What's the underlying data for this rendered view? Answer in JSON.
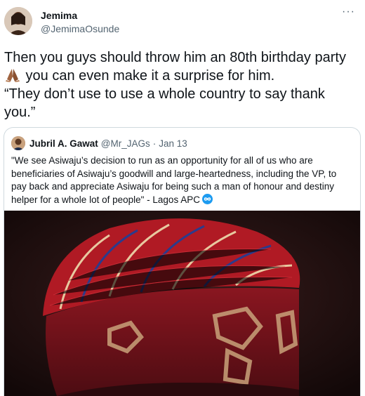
{
  "author": {
    "name": "Jemima",
    "handle": "@JemimaOsunde"
  },
  "more_label": "···",
  "tweet": {
    "line1_a": "Then you guys should throw him an 80th birthday party",
    "line2_b": " you can even make it a surprise for him.",
    "line3": "“They don’t use to use a whole country to say thank you.”",
    "emoji_icon": "folded-hands-icon"
  },
  "quote": {
    "name": "Jubril A. Gawat",
    "handle": "@Mr_JAGs",
    "separator": "·",
    "date": "Jan 13",
    "text": "\"We see Asiwaju’s decision to run as an opportunity for all of us who are beneficiaries of Asiwaju’s goodwill and large-heartedness, including the VP, to pay back and appreciate Asiwaju for being such a man of honour and destiny helper for a whole lot of people\" - Lagos APC",
    "badge_icon": "infinity-icon"
  },
  "colors": {
    "text": "#0f1419",
    "secondary": "#536471",
    "border": "#cfd9de",
    "accent": "#1d9bf0",
    "cap_red": "#b01a24"
  }
}
